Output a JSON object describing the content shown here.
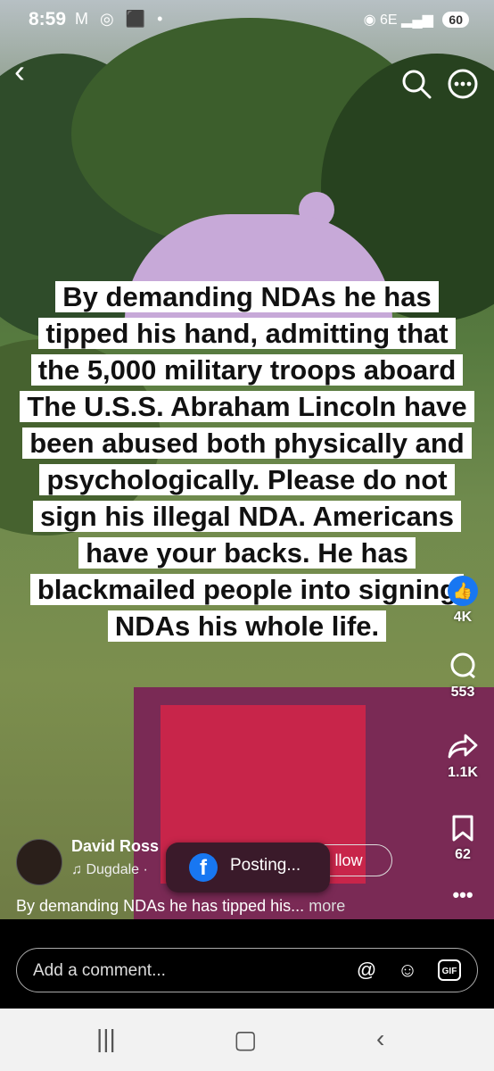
{
  "status": {
    "time": "8:59",
    "left_icons": "M ◎ ⬛ •",
    "network": "6E",
    "battery": "60"
  },
  "caption": "By demanding NDAs he has tipped his hand, admitting that the 5,000 military troops aboard The U.S.S. Abraham Lincoln have been abused both physically and psychologically. Please do not sign his illegal NDA. Americans have your backs. He has blackmailed people into signing NDAs his whole life.",
  "actions": {
    "likes": "4K",
    "comments": "553",
    "shares": "1.1K",
    "saves": "62"
  },
  "author": {
    "name": "David Ross",
    "music": "Dugdale ·",
    "follow": "llow"
  },
  "toast": {
    "text": "Posting..."
  },
  "description": {
    "text": "By demanding NDAs he has tipped his...",
    "more": "more"
  },
  "comment_input": {
    "placeholder": "Add a comment..."
  },
  "colors": {
    "facebook_blue": "#1877f2"
  }
}
